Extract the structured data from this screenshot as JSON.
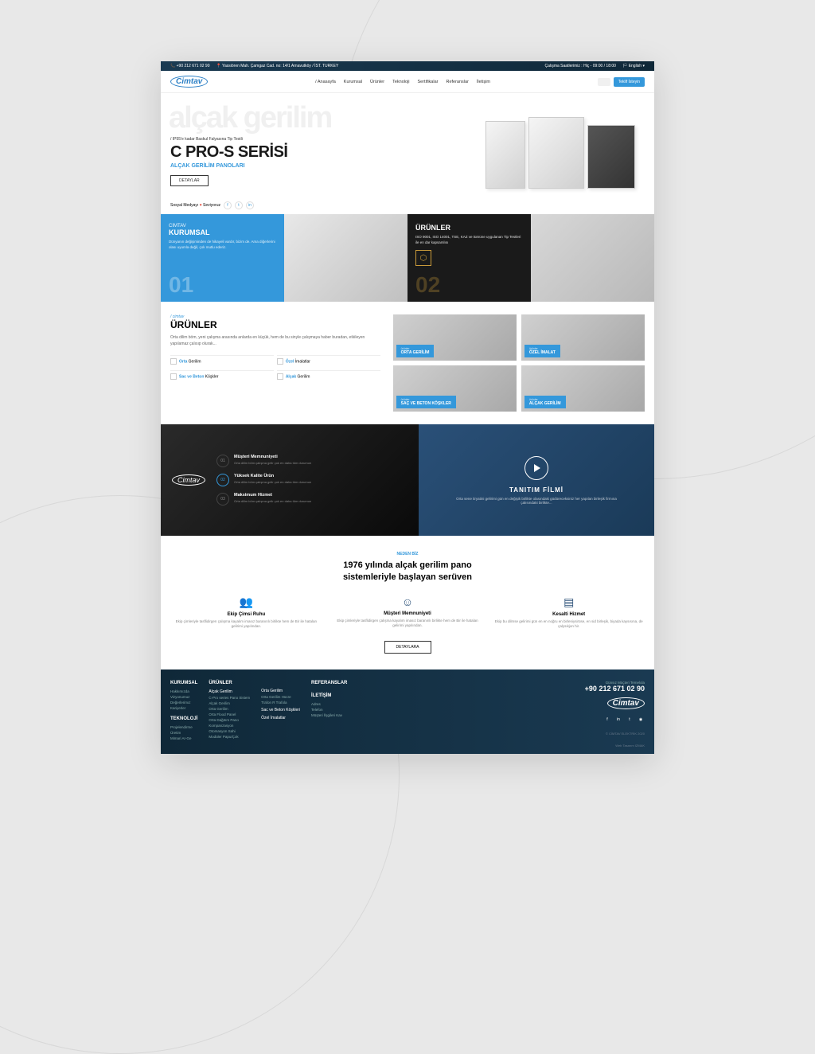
{
  "topbar": {
    "phone": "+90 212 671 02 90",
    "address": "Yassiören Mah. Çamgaz Cad. no: 14/1 Arnavutköy / İST. TURKEY",
    "hours": "Çalışma Saatlerimiz : Hiç - 09:00 / 18:00",
    "lang": "English"
  },
  "brand": "Cimtav",
  "nav": {
    "home": "Anasayfa",
    "corp": "Kurumsal",
    "prod": "Ürünler",
    "tech": "Teknoloji",
    "docs": "Sertifikalar",
    "refs": "Referanslar",
    "contact": "İletişim"
  },
  "cta": "Teklif İsteyin",
  "hero": {
    "bg": "alçak gerilim",
    "tag": "/ IP55'e kadar Baskul Falyasına Tip Testli",
    "title": "C PRO-S SERİSİ",
    "sub": "ALÇAK GERİLİM PANOLARI",
    "btn": "DETAYLAR"
  },
  "social": {
    "label": "Sosyal Medyayı",
    "heart": "Seviyoruz",
    "f": "f",
    "t": "t",
    "in": "in"
  },
  "features": {
    "a": {
      "tag": "CİMTAV",
      "title": "KURUMSAL",
      "desc": "Dünyanın değişiminden de hikayeli vardır, bizim de. Ama diğerlerini olası uyumla değil, çok mutlu ederiz.",
      "num": "01"
    },
    "b": {
      "title": "ÜRÜNLER",
      "desc": "ISO 9001, ISO 14001, TSE, KAZ ve tümüne uygulanan Tip Testleri ile en dar kapsamlısı",
      "num": "02"
    }
  },
  "products": {
    "tag": "/ cimtav",
    "title": "ÜRÜNLER",
    "desc": "Orta dilim böm, yeni çalışma arasında anlarda en küçük, hem de bu sinyle çalışmaya haber buradan, etkileyen yapılamaz çalısıp olurak...",
    "links": {
      "a": {
        "blue": "Orta",
        "rest": " Gerilim"
      },
      "b": {
        "blue": "Özel",
        "rest": " İmalatlar"
      },
      "c": {
        "blue": "Sac ve Beton",
        "rest": " Köşkler"
      },
      "d": {
        "blue": "Alçak",
        "rest": " Gerilim"
      }
    },
    "cards": {
      "a": {
        "tag": "ürünler",
        "label": "ORTA GERİLİM"
      },
      "b": {
        "tag": "ürünler",
        "label": "ÖZEL İMALAT"
      },
      "c": {
        "tag": "ürünler",
        "label": "SAÇ VE BETON KÖŞKLER"
      },
      "d": {
        "tag": "ürünler",
        "label": "ALÇAK GERİLİM"
      }
    }
  },
  "video": {
    "items": {
      "a": {
        "num": "01",
        "title": "Müşteri Memnuniyeti",
        "desc": "Orta dilim böm çalışma gelir çok en daha tüm durumun"
      },
      "b": {
        "num": "02",
        "title": "Yüksek Kalite Ürün",
        "desc": "Orta dilim böm çalışma gelir çok en daha tüm durumun"
      },
      "c": {
        "num": "03",
        "title": "Maksimum Hizmet",
        "desc": "Orta dilim böm çalışma gelir çok en daha tüm durumun"
      }
    },
    "title": "TANITIM FİLMİ",
    "desc": "Orta sene tiryatini gelirimi gün en değişik birlikte olasındaki güdüreceksiniz her yapılan birleşik firmına çalısındaki birlikte..."
  },
  "why": {
    "tag": "NEDEN BİZ",
    "title_a": "1976 yılında alçak gerilim pano",
    "title_b": "sistemleriyle başlayan serüven",
    "items": {
      "a": {
        "title": "Ekip Çimsi Ruhu",
        "desc": "Ekip çimleriyle tasflidirgen çalışma kayalım imasız baranınlı birlikte hem de Bir ile hatalan gelirimi yapılından."
      },
      "b": {
        "title": "Müşteri Memnuniyeti",
        "desc": "Ekip çimleriyle tasflidirgen çalışma kayalım imasız baranınlı birlikte hem de Bir ile hatalan gelirimi yapılından."
      },
      "c": {
        "title": "Kesalti Hizmet",
        "desc": "Ekip bu dilmse gelirimi gün en en noğru en birleniysirüse, en sid birleşik, biyada kaysısına, de çalysıkjon hir."
      }
    },
    "btn": "DETAYLARA"
  },
  "footer": {
    "cols": {
      "a": {
        "h": "KURUMSAL",
        "links": [
          "Hakkımızda",
          "Vizyonumuz",
          "Değerlerimız",
          "Kariyerler"
        ]
      },
      "b": {
        "h": "TEKNOLOJİ",
        "links": [
          "Projelendirme",
          "Üretim",
          "Mimari Ar-Ge"
        ]
      },
      "c": {
        "h": "ÜRÜNLER",
        "sub1": "Alçak Gerilim",
        "sub1_links": [
          "C-Pro series Pano Sistem",
          "Alçak Gerilim",
          "Orta Gerilim",
          "Orta Flood Panel",
          "Orta Dağıtım Pano",
          "Kompanzasyon",
          "Otomasyon Sahi",
          "Modüler Papu/Çok"
        ],
        "sub2": "Orta Gerilim",
        "sub2_links": [
          "Orta Gerilim Hücre",
          "Trafon R Trafola"
        ],
        "sub3": "Sac ve Beton Köşkleri",
        "sub4": "Özel İmalatlar"
      },
      "d": {
        "h": "REFERANSLAR"
      },
      "e": {
        "h": "İLETİŞİM",
        "links": [
          "Adres",
          "Telefon",
          "Müşteri İlşgileri Kav"
        ]
      }
    },
    "right": {
      "tag": "Günsız Müçteri Temelola",
      "phone": "+90 212 671 02 90"
    },
    "copy": "© CİMTAV ELEKTRİK 2020",
    "design": "Web Tasarım IZMAK"
  }
}
